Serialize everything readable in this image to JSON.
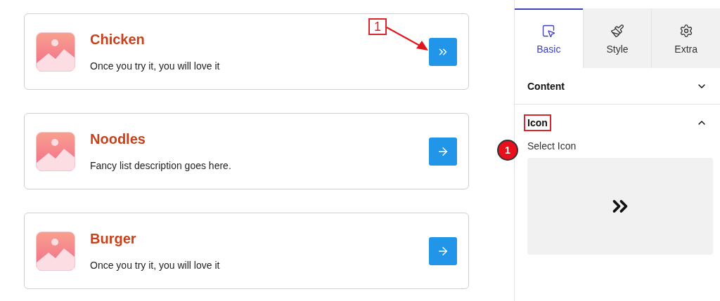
{
  "list_items": [
    {
      "title": "Chicken",
      "description": "Once you try it, you will love it",
      "kind": "double-chevron"
    },
    {
      "title": "Noodles",
      "description": "Fancy list description goes here.",
      "kind": "arrow"
    },
    {
      "title": "Burger",
      "description": "Once you try it, you will love it",
      "kind": "arrow"
    }
  ],
  "callouts": [
    {
      "label": "1",
      "kind": "box-arrow"
    },
    {
      "label": "1",
      "kind": "circle"
    }
  ],
  "panel": {
    "tabs": [
      {
        "label": "Basic",
        "selected": true
      },
      {
        "label": "Style",
        "selected": false
      },
      {
        "label": "Extra",
        "selected": false
      }
    ],
    "sections": [
      {
        "title": "Content",
        "expanded": false,
        "highlighted": false
      },
      {
        "title": "Icon",
        "expanded": true,
        "highlighted": true
      }
    ],
    "field": {
      "label": "Select Icon"
    }
  }
}
